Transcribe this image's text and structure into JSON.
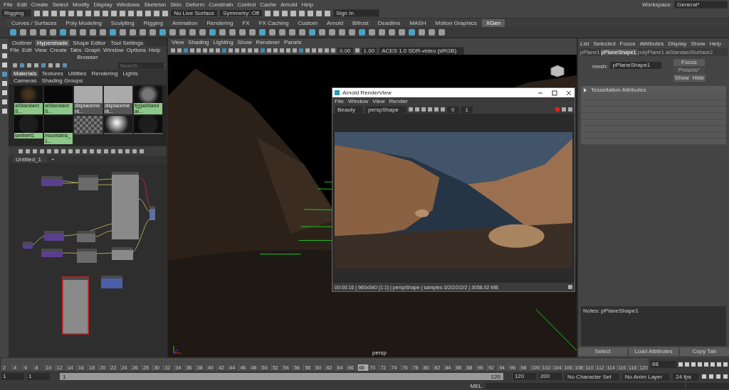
{
  "main_menu": [
    "File",
    "Edit",
    "Create",
    "Select",
    "Modify",
    "Display",
    "Windows",
    "Skeleton",
    "Skin",
    "Deform",
    "Constrain",
    "Control",
    "Cache",
    "Arnold",
    "Help"
  ],
  "workspace": {
    "label": "Workspace:",
    "value": "General*"
  },
  "status_line": {
    "menu_set": "Rigging",
    "live_surface": "No Live Surface",
    "symmetry": "Symmetry: Off",
    "sign_in": "Sign In"
  },
  "shelf_tabs": [
    {
      "label": "Curves / Surfaces",
      "selected": false
    },
    {
      "label": "Poly Modeling",
      "selected": false
    },
    {
      "label": "Sculpting",
      "selected": false
    },
    {
      "label": "Rigging",
      "selected": false
    },
    {
      "label": "Animation",
      "selected": false
    },
    {
      "label": "Rendering",
      "selected": false
    },
    {
      "label": "FX",
      "selected": false
    },
    {
      "label": "FX Caching",
      "selected": false
    },
    {
      "label": "Custom",
      "selected": false
    },
    {
      "label": "Arnold",
      "selected": false
    },
    {
      "label": "Bifrost",
      "selected": false
    },
    {
      "label": "Deadline",
      "selected": false
    },
    {
      "label": "MASH",
      "selected": false
    },
    {
      "label": "Motion Graphics",
      "selected": false
    },
    {
      "label": "XGen",
      "selected": true
    }
  ],
  "hypershade": {
    "panel_tabs": [
      {
        "label": "Outliner",
        "selected": false
      },
      {
        "label": "Hypershade",
        "selected": true
      },
      {
        "label": "Shape Editor",
        "selected": false
      },
      {
        "label": "Tool Settings",
        "selected": false
      }
    ],
    "menu": [
      "File",
      "Edit",
      "View",
      "Create",
      "Tabs",
      "Graph",
      "Window",
      "Options",
      "Help"
    ],
    "browser_title": "Browser",
    "search_placeholder": "Search...",
    "browser_tabs": [
      {
        "label": "Materials",
        "selected": true
      },
      {
        "label": "Textures",
        "selected": false
      },
      {
        "label": "Utilities",
        "selected": false
      },
      {
        "label": "Rendering",
        "selected": false
      },
      {
        "label": "Lights",
        "selected": false
      },
      {
        "label": "Cameras",
        "selected": false
      },
      {
        "label": "Shading Groups",
        "selected": false
      }
    ],
    "swatches": [
      {
        "label": "aiStandardS...",
        "kind": "speckle",
        "selected": true
      },
      {
        "label": "aiStandardS...",
        "kind": "dark",
        "selected": true
      },
      {
        "label": "displacement...",
        "kind": "node",
        "selected": false
      },
      {
        "label": "displacement...",
        "kind": "node",
        "selected": false
      },
      {
        "label": "f(g)aiStandar...",
        "kind": "rock",
        "selected": true
      },
      {
        "label": "lambert1",
        "kind": "sphere",
        "selected": true
      },
      {
        "label": "mountains_1...",
        "kind": "logo",
        "selected": true
      },
      {
        "kind": "checker",
        "selected": false
      },
      {
        "kind": "chrome",
        "selected": false
      },
      {
        "kind": "sphere",
        "selected": false
      }
    ],
    "editor_tab": "Untitled_1",
    "add_tab": "+"
  },
  "viewport": {
    "menu": [
      "View",
      "Shading",
      "Lighting",
      "Show",
      "Renderer",
      "Panels"
    ],
    "exposure": "0.00",
    "gamma": "1.00",
    "view_transform": "ACES 1.0 SDR-video (sRGB)",
    "camera": "persp"
  },
  "render_view": {
    "title": "Arnold RenderView",
    "menu": [
      "File",
      "Window",
      "View",
      "Render"
    ],
    "aov": "Beauty",
    "camera": "perspShape",
    "value_a": "0",
    "value_b": "1",
    "status": "00:00:16 | 960x540 (1:1) | perspShape | samples 3/2/2/2/2/2 | 3058.02 MB"
  },
  "attribute_editor": {
    "menu": [
      "List",
      "Selected",
      "Focus",
      "Attributes",
      "Display",
      "Show",
      "Help"
    ],
    "tabs": [
      {
        "label": "pPlane1",
        "selected": false
      },
      {
        "label": "pPlaneShape1",
        "selected": true
      },
      {
        "label": "polyPlane1",
        "selected": false
      },
      {
        "label": "aiStandardSurface2",
        "selected": false
      }
    ],
    "node_label": "mesh:",
    "node_name": "pPlaneShape1",
    "focus": "Focus",
    "presets": "Presets*",
    "show": "Show",
    "hide": "Hide",
    "sections": [
      {
        "label": "Tessellation Attributes",
        "expanded": false
      }
    ],
    "notes": "Notes:  pPlaneShape1",
    "buttons": [
      "Select",
      "Load Attributes",
      "Copy Tab"
    ]
  },
  "timeline": {
    "ticks": [
      {
        "label": "2",
        "selected": false
      },
      {
        "label": "4",
        "selected": false
      },
      {
        "label": "6",
        "selected": false
      },
      {
        "label": "8",
        "selected": false
      },
      {
        "label": "10",
        "selected": false
      },
      {
        "label": "12",
        "selected": false
      },
      {
        "label": "14",
        "selected": false
      },
      {
        "label": "16",
        "selected": false
      },
      {
        "label": "18",
        "selected": false
      },
      {
        "label": "20",
        "selected": false
      },
      {
        "label": "22",
        "selected": false
      },
      {
        "label": "24",
        "selected": false
      },
      {
        "label": "26",
        "selected": false
      },
      {
        "label": "28",
        "selected": false
      },
      {
        "label": "30",
        "selected": false
      },
      {
        "label": "32",
        "selected": false
      },
      {
        "label": "34",
        "selected": false
      },
      {
        "label": "36",
        "selected": false
      },
      {
        "label": "38",
        "selected": false
      },
      {
        "label": "40",
        "selected": false
      },
      {
        "label": "42",
        "selected": false
      },
      {
        "label": "44",
        "selected": false
      },
      {
        "label": "46",
        "selected": false
      },
      {
        "label": "48",
        "selected": false
      },
      {
        "label": "50",
        "selected": false
      },
      {
        "label": "52",
        "selected": false
      },
      {
        "label": "54",
        "selected": false
      },
      {
        "label": "56",
        "selected": false
      },
      {
        "label": "58",
        "selected": false
      },
      {
        "label": "60",
        "selected": false
      },
      {
        "label": "62",
        "selected": false
      },
      {
        "label": "64",
        "selected": false
      },
      {
        "label": "66",
        "selected": false
      },
      {
        "label": "68",
        "selected": true
      },
      {
        "label": "70",
        "selected": false
      },
      {
        "label": "72",
        "selected": false
      },
      {
        "label": "74",
        "selected": false
      },
      {
        "label": "76",
        "selected": false
      },
      {
        "label": "78",
        "selected": false
      },
      {
        "label": "80",
        "selected": false
      },
      {
        "label": "82",
        "selected": false
      },
      {
        "label": "84",
        "selected": false
      },
      {
        "label": "86",
        "selected": false
      },
      {
        "label": "88",
        "selected": false
      },
      {
        "label": "90",
        "selected": false
      },
      {
        "label": "92",
        "selected": false
      },
      {
        "label": "94",
        "selected": false
      },
      {
        "label": "96",
        "selected": false
      },
      {
        "label": "98",
        "selected": false
      },
      {
        "label": "100",
        "selected": false
      },
      {
        "label": "102",
        "selected": false
      },
      {
        "label": "104",
        "selected": false
      },
      {
        "label": "106",
        "selected": false
      },
      {
        "label": "108",
        "selected": false
      },
      {
        "label": "110",
        "selected": false
      },
      {
        "label": "112",
        "selected": false
      },
      {
        "label": "114",
        "selected": false
      },
      {
        "label": "116",
        "selected": false
      },
      {
        "label": "118",
        "selected": false
      },
      {
        "label": "120",
        "selected": false
      }
    ],
    "current_field": "68"
  },
  "range": {
    "start": "1",
    "inner_start": "1",
    "slider_start": "1",
    "slider_end": "120",
    "level": 1,
    "end": "120",
    "outer_end": "200",
    "character_set": "No Character Set",
    "anim_layer": "No Anim Layer",
    "fps": "24 fps"
  },
  "command_line": {
    "language": "MEL"
  }
}
